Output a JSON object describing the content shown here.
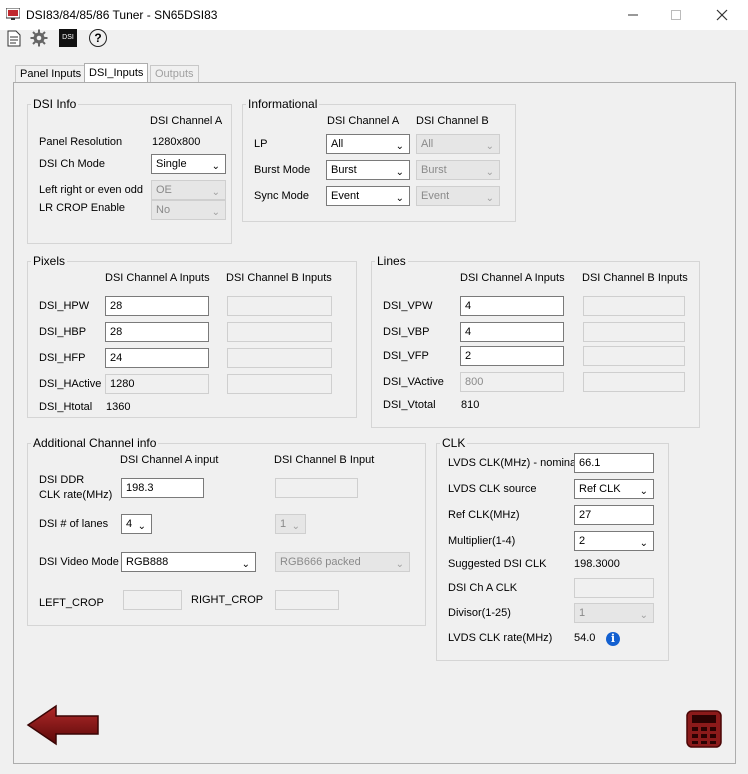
{
  "window": {
    "title": "DSI83/84/85/86 Tuner - SN65DSI83"
  },
  "toolbar": {
    "icons": [
      "document-icon",
      "gear-icon",
      "dsi-icon",
      "help-icon"
    ],
    "dsi_text": "DSI",
    "help_text": "?"
  },
  "tabs": [
    {
      "label": "Panel Inputs",
      "state": "normal"
    },
    {
      "label": "DSI_Inputs",
      "state": "active"
    },
    {
      "label": "Outputs",
      "state": "disabled"
    }
  ],
  "dsi_info": {
    "title": "DSI Info",
    "col_a": "DSI Channel A",
    "panel_resolution_label": "Panel Resolution",
    "panel_resolution_value": "1280x800",
    "ch_mode_label": "DSI Ch Mode",
    "ch_mode_value": "Single",
    "lr_label": "Left right or even odd",
    "lr_value": "OE",
    "crop_label": "LR CROP Enable",
    "crop_value": "No"
  },
  "informational": {
    "title": "Informational",
    "col_a": "DSI Channel A",
    "col_b": "DSI Channel B",
    "rows": [
      {
        "label": "LP",
        "a": "All",
        "b": "All"
      },
      {
        "label": "Burst Mode",
        "a": "Burst",
        "b": "Burst"
      },
      {
        "label": "Sync Mode",
        "a": "Event",
        "b": "Event"
      }
    ]
  },
  "pixels": {
    "title": "Pixels",
    "col_a": "DSI Channel A Inputs",
    "col_b": "DSI Channel B Inputs",
    "rows": [
      {
        "label": "DSI_HPW",
        "a": "28",
        "b": ""
      },
      {
        "label": "DSI_HBP",
        "a": "28",
        "b": ""
      },
      {
        "label": "DSI_HFP",
        "a": "24",
        "b": ""
      },
      {
        "label": "DSI_HActive",
        "a": "1280",
        "b": ""
      }
    ],
    "total_label": "DSI_Htotal",
    "total_value": "1360"
  },
  "lines": {
    "title": "Lines",
    "col_a": "DSI Channel A Inputs",
    "col_b": "DSI Channel B Inputs",
    "rows": [
      {
        "label": "DSI_VPW",
        "a": "4",
        "b": ""
      },
      {
        "label": "DSI_VBP",
        "a": "4",
        "b": ""
      },
      {
        "label": "DSI_VFP",
        "a": "2",
        "b": ""
      },
      {
        "label": "DSI_VActive",
        "a": "800",
        "b": ""
      }
    ],
    "total_label": "DSI_Vtotal",
    "total_value": "810"
  },
  "additional": {
    "title": "Additional Channel info",
    "col_a": "DSI Channel A input",
    "col_b": "DSI Channel B Input",
    "ddr_label_1": "DSI DDR",
    "ddr_label_2": "CLK rate(MHz)",
    "ddr_a": "198.3",
    "ddr_b": "",
    "lanes_label": "DSI # of lanes",
    "lanes_a": "4",
    "lanes_b": "1",
    "video_label": "DSI Video Mode",
    "video_a": "RGB888",
    "video_b": "RGB666 packed",
    "left_crop_label": "LEFT_CROP",
    "left_crop_value": "",
    "right_crop_label": "RIGHT_CROP",
    "right_crop_value": ""
  },
  "clk": {
    "title": "CLK",
    "lvds_nominal_label": "LVDS CLK(MHz) - nominal",
    "lvds_nominal_value": "66.1",
    "lvds_source_label": "LVDS CLK source",
    "lvds_source_value": "Ref CLK",
    "ref_label": "Ref CLK(MHz)",
    "ref_value": "27",
    "mult_label": "Multiplier(1-4)",
    "mult_value": "2",
    "suggested_label": "Suggested DSI CLK",
    "suggested_value": "198.3000",
    "dsi_a_clk_label": "DSI Ch A CLK",
    "dsi_a_clk_value": "",
    "divisor_label": "Divisor(1-25)",
    "divisor_value": "1",
    "lvds_rate_label": "LVDS CLK rate(MHz)",
    "lvds_rate_value": "54.0",
    "info_glyph": "i"
  },
  "colors": {
    "arrow": "#7a0e0e",
    "calculator": "#8b1a1a",
    "info": "#1360d0"
  }
}
